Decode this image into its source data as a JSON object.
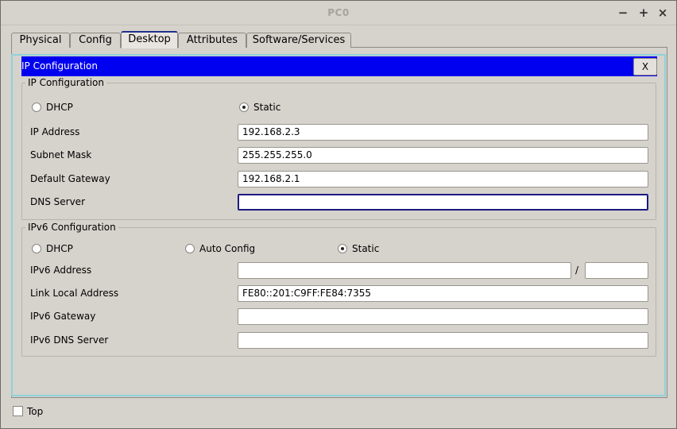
{
  "window": {
    "title": "PC0",
    "minimize": "−",
    "maximize": "+",
    "close": "×"
  },
  "tabs": [
    {
      "label": "Physical"
    },
    {
      "label": "Config"
    },
    {
      "label": "Desktop"
    },
    {
      "label": "Attributes"
    },
    {
      "label": "Software/Services"
    }
  ],
  "active_tab": "Desktop",
  "dialog": {
    "title": "IP Configuration",
    "close_label": "X"
  },
  "ipv4": {
    "group_title": "IP Configuration",
    "dhcp_label": "DHCP",
    "static_label": "Static",
    "mode": "Static",
    "ip_address_label": "IP Address",
    "ip_address": "192.168.2.3",
    "subnet_mask_label": "Subnet Mask",
    "subnet_mask": "255.255.255.0",
    "default_gateway_label": "Default Gateway",
    "default_gateway": "192.168.2.1",
    "dns_server_label": "DNS Server",
    "dns_server": ""
  },
  "ipv6": {
    "group_title": "IPv6 Configuration",
    "dhcp_label": "DHCP",
    "auto_config_label": "Auto Config",
    "static_label": "Static",
    "mode": "Static",
    "address_label": "IPv6 Address",
    "address": "",
    "prefix_separator": "/",
    "prefix": "",
    "link_local_label": "Link Local Address",
    "link_local": "FE80::201:C9FF:FE84:7355",
    "gateway_label": "IPv6 Gateway",
    "gateway": "",
    "dns_server_label": "IPv6 DNS Server",
    "dns_server": ""
  },
  "footer": {
    "top_label": "Top",
    "top_checked": false
  },
  "colors": {
    "dialog_titlebar": "#0000f0",
    "inner_border": "#8fd2d8",
    "window_bg": "#d6d2cc"
  }
}
